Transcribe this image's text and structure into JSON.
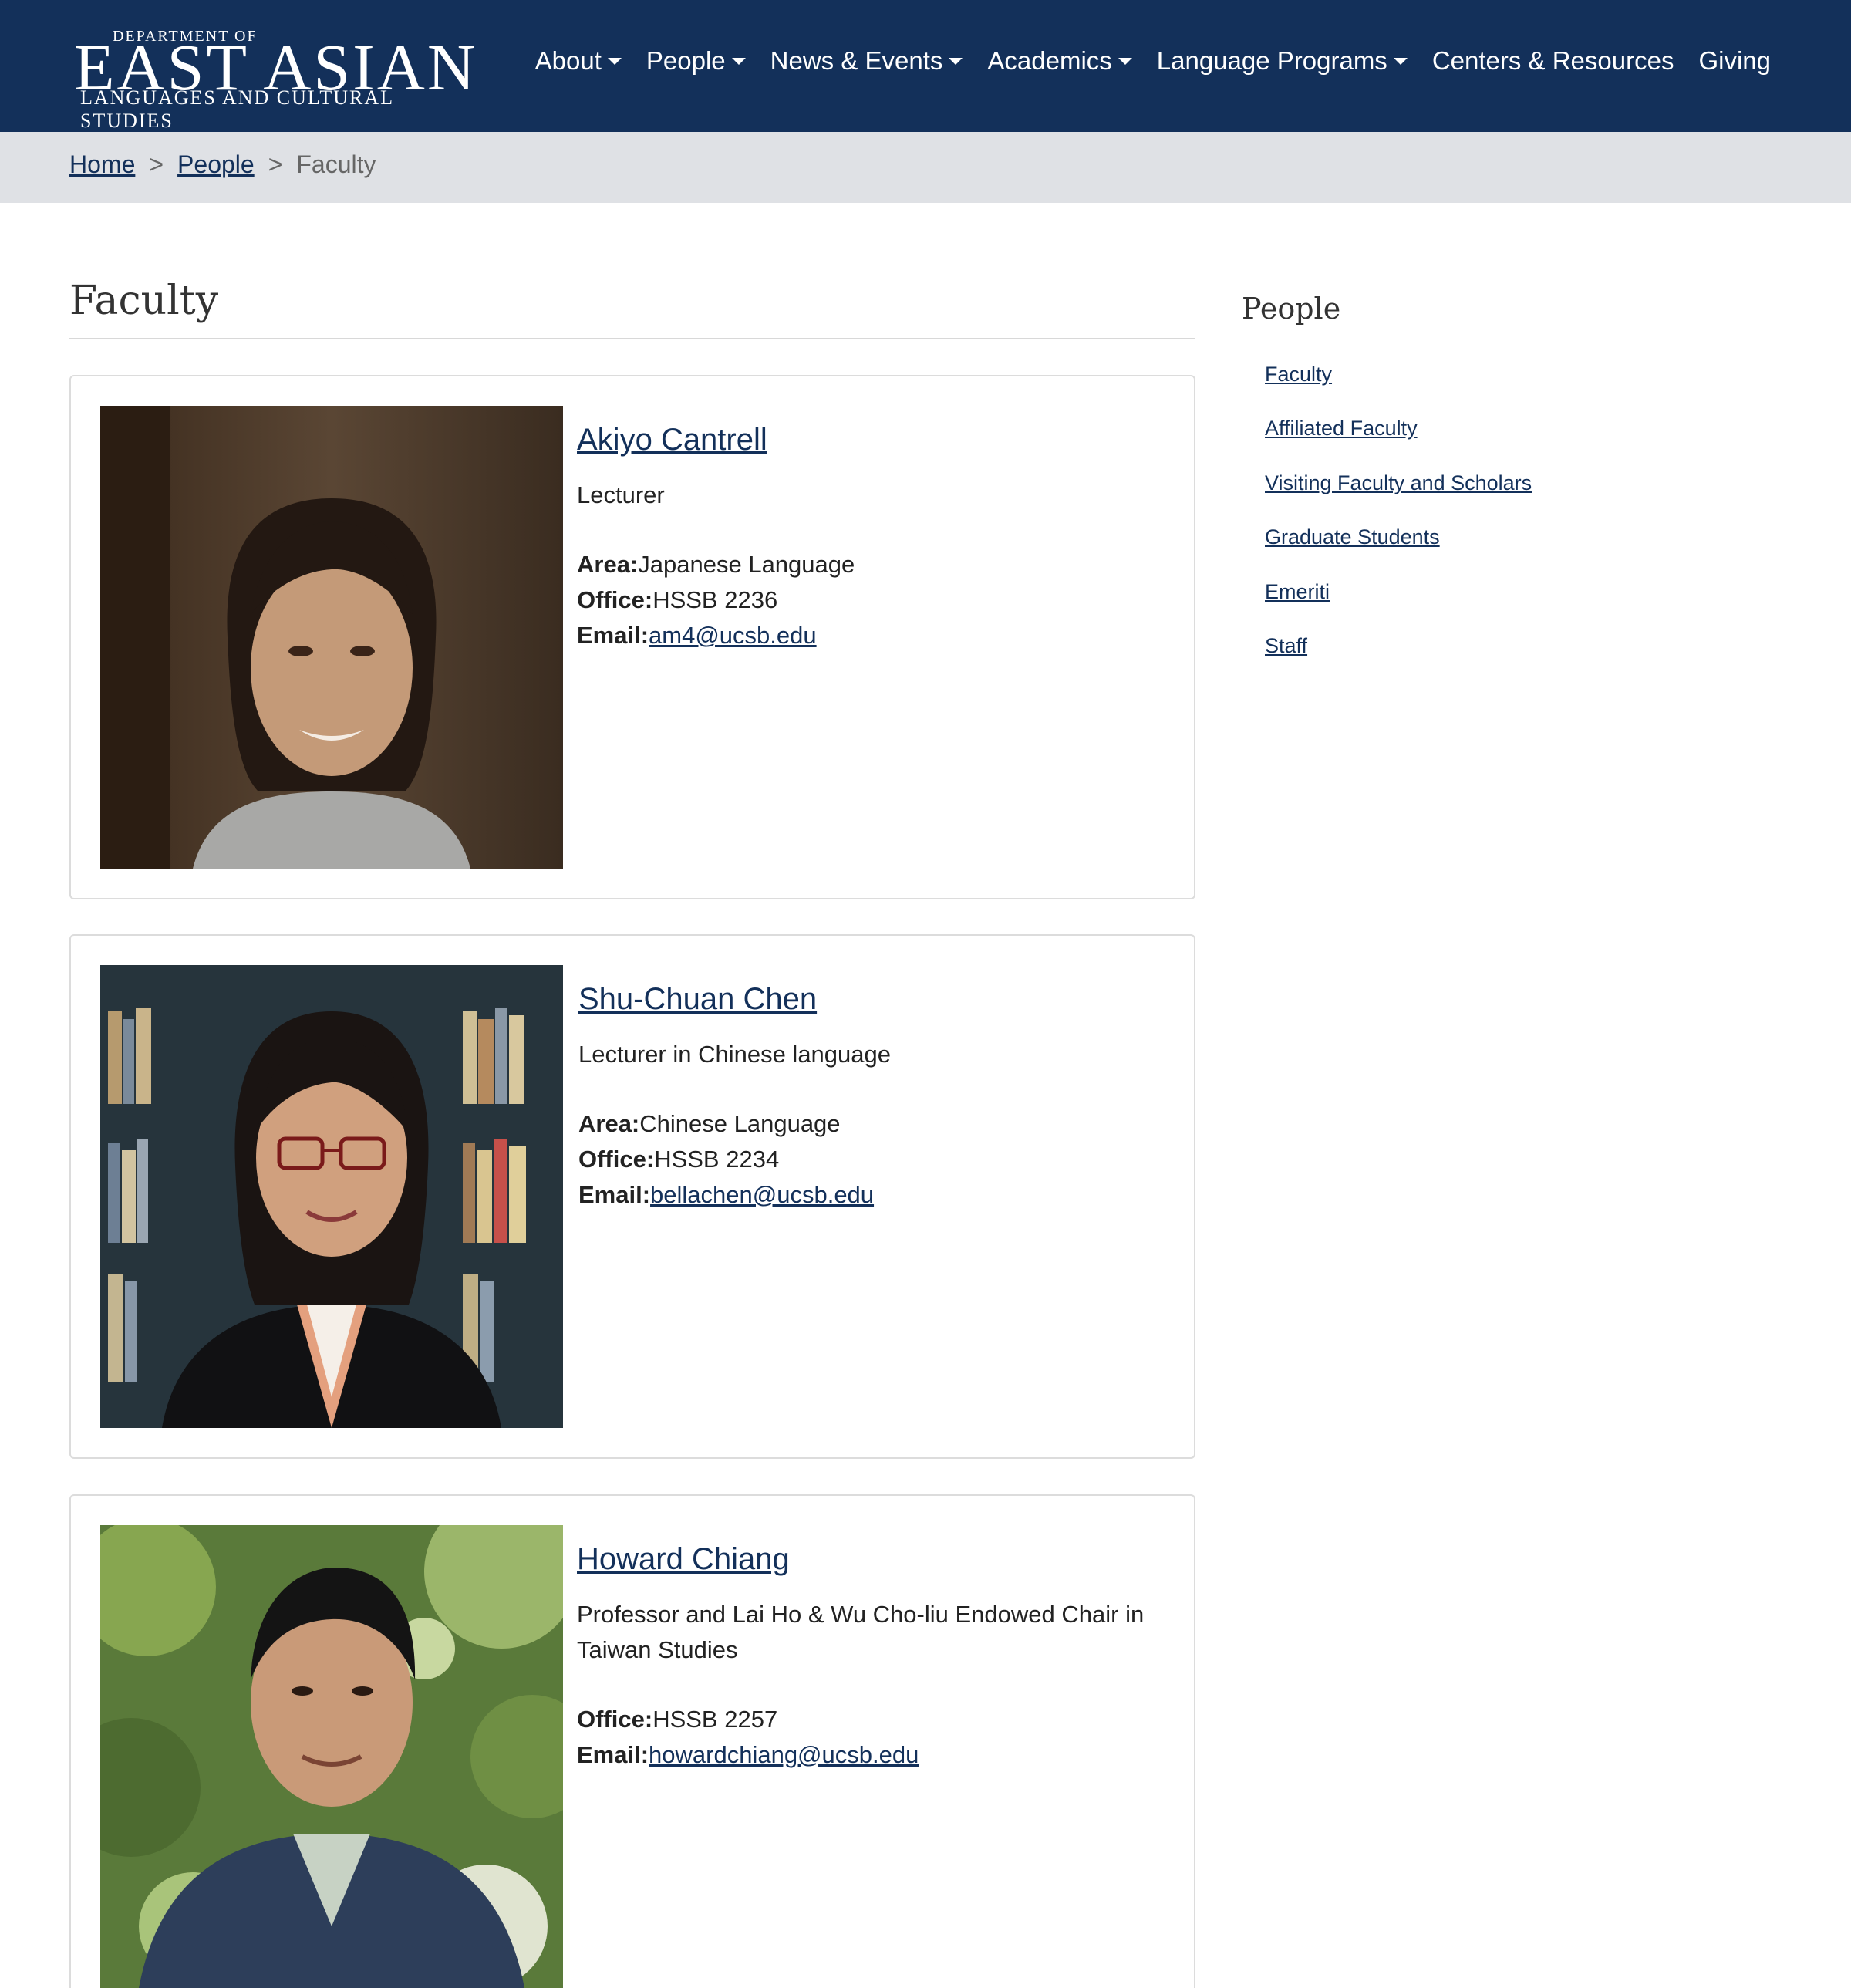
{
  "header": {
    "logo": {
      "dept": "DEPARTMENT OF",
      "main": "EAST ASIAN",
      "sub": "LANGUAGES AND CULTURAL STUDIES"
    },
    "nav": [
      {
        "label": "About",
        "dropdown": true
      },
      {
        "label": "People",
        "dropdown": true
      },
      {
        "label": "News & Events",
        "dropdown": true
      },
      {
        "label": "Academics",
        "dropdown": true
      },
      {
        "label": "Language Programs",
        "dropdown": true
      },
      {
        "label": "Centers & Resources",
        "dropdown": false
      },
      {
        "label": "Giving",
        "dropdown": false
      }
    ],
    "colors": {
      "bar": "#13305a",
      "text": "#ffffff"
    }
  },
  "breadcrumb": {
    "items": [
      "Home",
      "People"
    ],
    "separator": ">",
    "current": "Faculty"
  },
  "main": {
    "title": "Faculty",
    "faculty": [
      {
        "name": "Akiyo Cantrell",
        "title": "Lecturer",
        "area_label": "Area:",
        "area": "Japanese Language",
        "office_label": "Office:",
        "office": "HSSB 2236",
        "email_label": "Email:",
        "email": "am4@ucsb.edu"
      },
      {
        "name": "Shu-Chuan Chen",
        "title": "Lecturer in Chinese language",
        "area_label": "Area:",
        "area": "Chinese Language",
        "office_label": "Office:",
        "office": "HSSB 2234",
        "email_label": "Email:",
        "email": "bellachen@ucsb.edu"
      },
      {
        "name": "Howard Chiang",
        "title": "Professor and Lai Ho & Wu Cho-liu Endowed Chair in Taiwan Studies",
        "office_label": "Office:",
        "office": "HSSB 2257",
        "email_label": "Email:",
        "email": "howardchiang@ucsb.edu"
      }
    ]
  },
  "sidebar": {
    "title": "People",
    "items": [
      "Faculty",
      "Affiliated Faculty",
      "Visiting Faculty and Scholars",
      "Graduate Students",
      "Emeriti",
      "Staff"
    ]
  },
  "colors": {
    "link": "#13305a",
    "breadcrumb_bg": "#dfe1e5",
    "card_border": "#dcdcdc"
  }
}
